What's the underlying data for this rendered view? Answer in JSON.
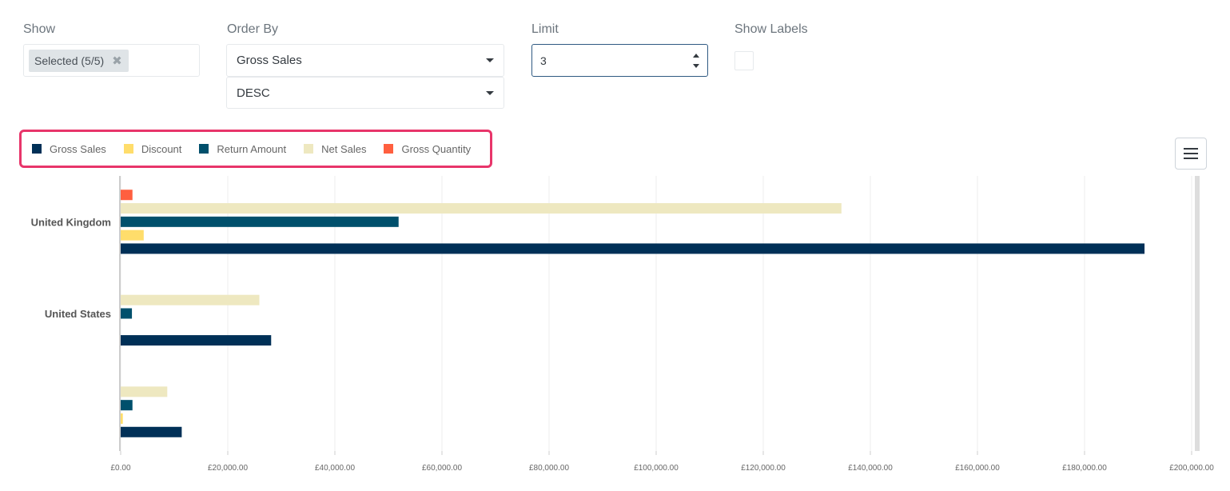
{
  "controls": {
    "show": {
      "label": "Show",
      "chip": "Selected (5/5)",
      "remove_glyph": "✖"
    },
    "order_by": {
      "label": "Order By",
      "field": "Gross Sales",
      "direction": "DESC"
    },
    "limit": {
      "label": "Limit",
      "value": "3"
    },
    "show_labels": {
      "label": "Show Labels",
      "checked": false
    }
  },
  "menu": {
    "icon": "hamburger-menu-icon"
  },
  "chart_data": {
    "type": "bar",
    "orientation": "horizontal",
    "categories": [
      "United Kingdom",
      "United States",
      ""
    ],
    "series": [
      {
        "name": "Gross Sales",
        "color": "#003057",
        "values": [
          191200,
          28100,
          11400
        ]
      },
      {
        "name": "Discount",
        "color": "#ffdd6b",
        "values": [
          4300,
          0,
          400
        ]
      },
      {
        "name": "Return Amount",
        "color": "#00506c",
        "values": [
          51900,
          2100,
          2200
        ]
      },
      {
        "name": "Net Sales",
        "color": "#eee8c0",
        "values": [
          134600,
          25900,
          8700
        ]
      },
      {
        "name": "Gross Quantity",
        "color": "#ff5f3f",
        "values": [
          2200,
          0,
          0
        ]
      }
    ],
    "xlim": [
      0,
      200000
    ],
    "xticks": [
      0,
      20000,
      40000,
      60000,
      80000,
      100000,
      120000,
      140000,
      160000,
      180000,
      200000
    ],
    "xtick_labels": [
      "£0.00",
      "£20,000.00",
      "£40,000.00",
      "£60,000.00",
      "£80,000.00",
      "£100,000.00",
      "£120,000.00",
      "£140,000.00",
      "£160,000.00",
      "£180,000.00",
      "£200,000.00"
    ],
    "grid": true,
    "legend_position": "top-left",
    "show_data_labels": false
  }
}
